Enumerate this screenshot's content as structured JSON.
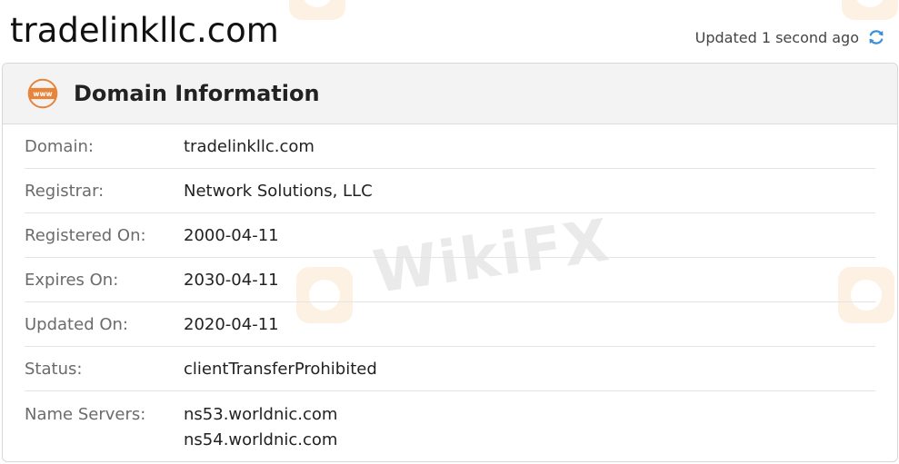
{
  "site_title": "tradelinkllc.com",
  "updated_text": "Updated 1 second ago",
  "card": {
    "title": "Domain Information",
    "icon": "www-icon"
  },
  "rows": [
    {
      "label": "Domain:",
      "value": "tradelinkllc.com"
    },
    {
      "label": "Registrar:",
      "value": "Network Solutions, LLC"
    },
    {
      "label": "Registered On:",
      "value": "2000-04-11"
    },
    {
      "label": "Expires On:",
      "value": "2030-04-11"
    },
    {
      "label": "Updated On:",
      "value": "2020-04-11"
    },
    {
      "label": "Status:",
      "value": "clientTransferProhibited"
    },
    {
      "label": "Name Servers:",
      "values": [
        "ns53.worldnic.com",
        "ns54.worldnic.com"
      ]
    }
  ],
  "watermark": {
    "text": "WikiFX"
  },
  "colors": {
    "accent_orange": "#e8843a",
    "refresh_blue": "#3a8fd8",
    "header_bg": "#f3f3f3"
  }
}
